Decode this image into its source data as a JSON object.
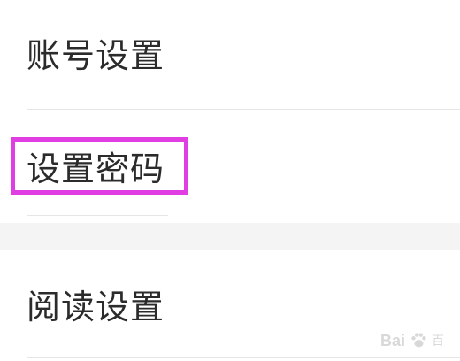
{
  "settings": {
    "items": [
      {
        "label": "账号设置"
      },
      {
        "label": "设置密码",
        "highlighted": true
      },
      {
        "label": "阅读设置"
      }
    ]
  },
  "colors": {
    "highlight": "#e03ee3",
    "text": "#2b2b2b",
    "divider": "#e6e6e6",
    "section_gap": "#f4f4f4"
  },
  "watermark": {
    "brand": "Bai",
    "brand_tail": "百",
    "icon": "paw-icon"
  }
}
